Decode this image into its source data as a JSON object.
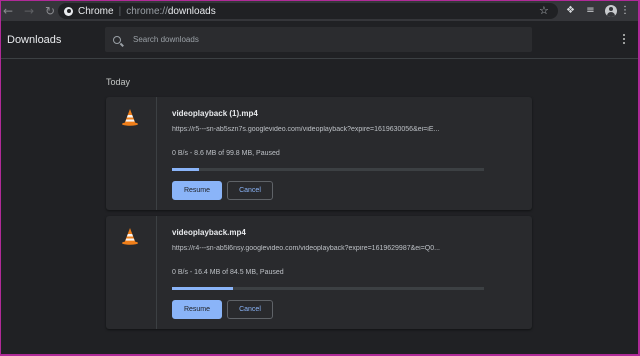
{
  "browser": {
    "omnibox_app_label": "Chrome",
    "omnibox_scheme": "chrome://",
    "omnibox_host": "downloads"
  },
  "header": {
    "title": "Downloads",
    "search_placeholder": "Search downloads"
  },
  "section_date": "Today",
  "downloads": [
    {
      "file_name": "videoplayback (1).mp4",
      "url": "https://r5---sn-ab5szn7s.googlevideo.com/videoplayback?expire=1619630056&ei=iE...",
      "status": "0 B/s - 8.6 MB of 99.8 MB, Paused",
      "progress_fraction": 0.086,
      "resume_label": "Resume",
      "cancel_label": "Cancel"
    },
    {
      "file_name": "videoplayback.mp4",
      "url": "https://r4---sn-ab5l6nsy.googlevideo.com/videoplayback?expire=1619629987&ei=Q0...",
      "status": "0 B/s - 16.4 MB of 84.5 MB, Paused",
      "progress_fraction": 0.194,
      "resume_label": "Resume",
      "cancel_label": "Cancel"
    }
  ],
  "colors": {
    "accent": "#8ab4f8",
    "background": "#202124",
    "card": "#292a2d",
    "vlc_orange": "#f07f1a"
  },
  "icons": {
    "back": "arrow-left-icon",
    "forward": "arrow-right-icon",
    "star": "star-icon",
    "extensions": "puzzle-icon",
    "media": "media-queue-icon",
    "profile": "avatar-icon",
    "menu": "kebab-menu-icon",
    "file": "vlc-cone-icon"
  }
}
